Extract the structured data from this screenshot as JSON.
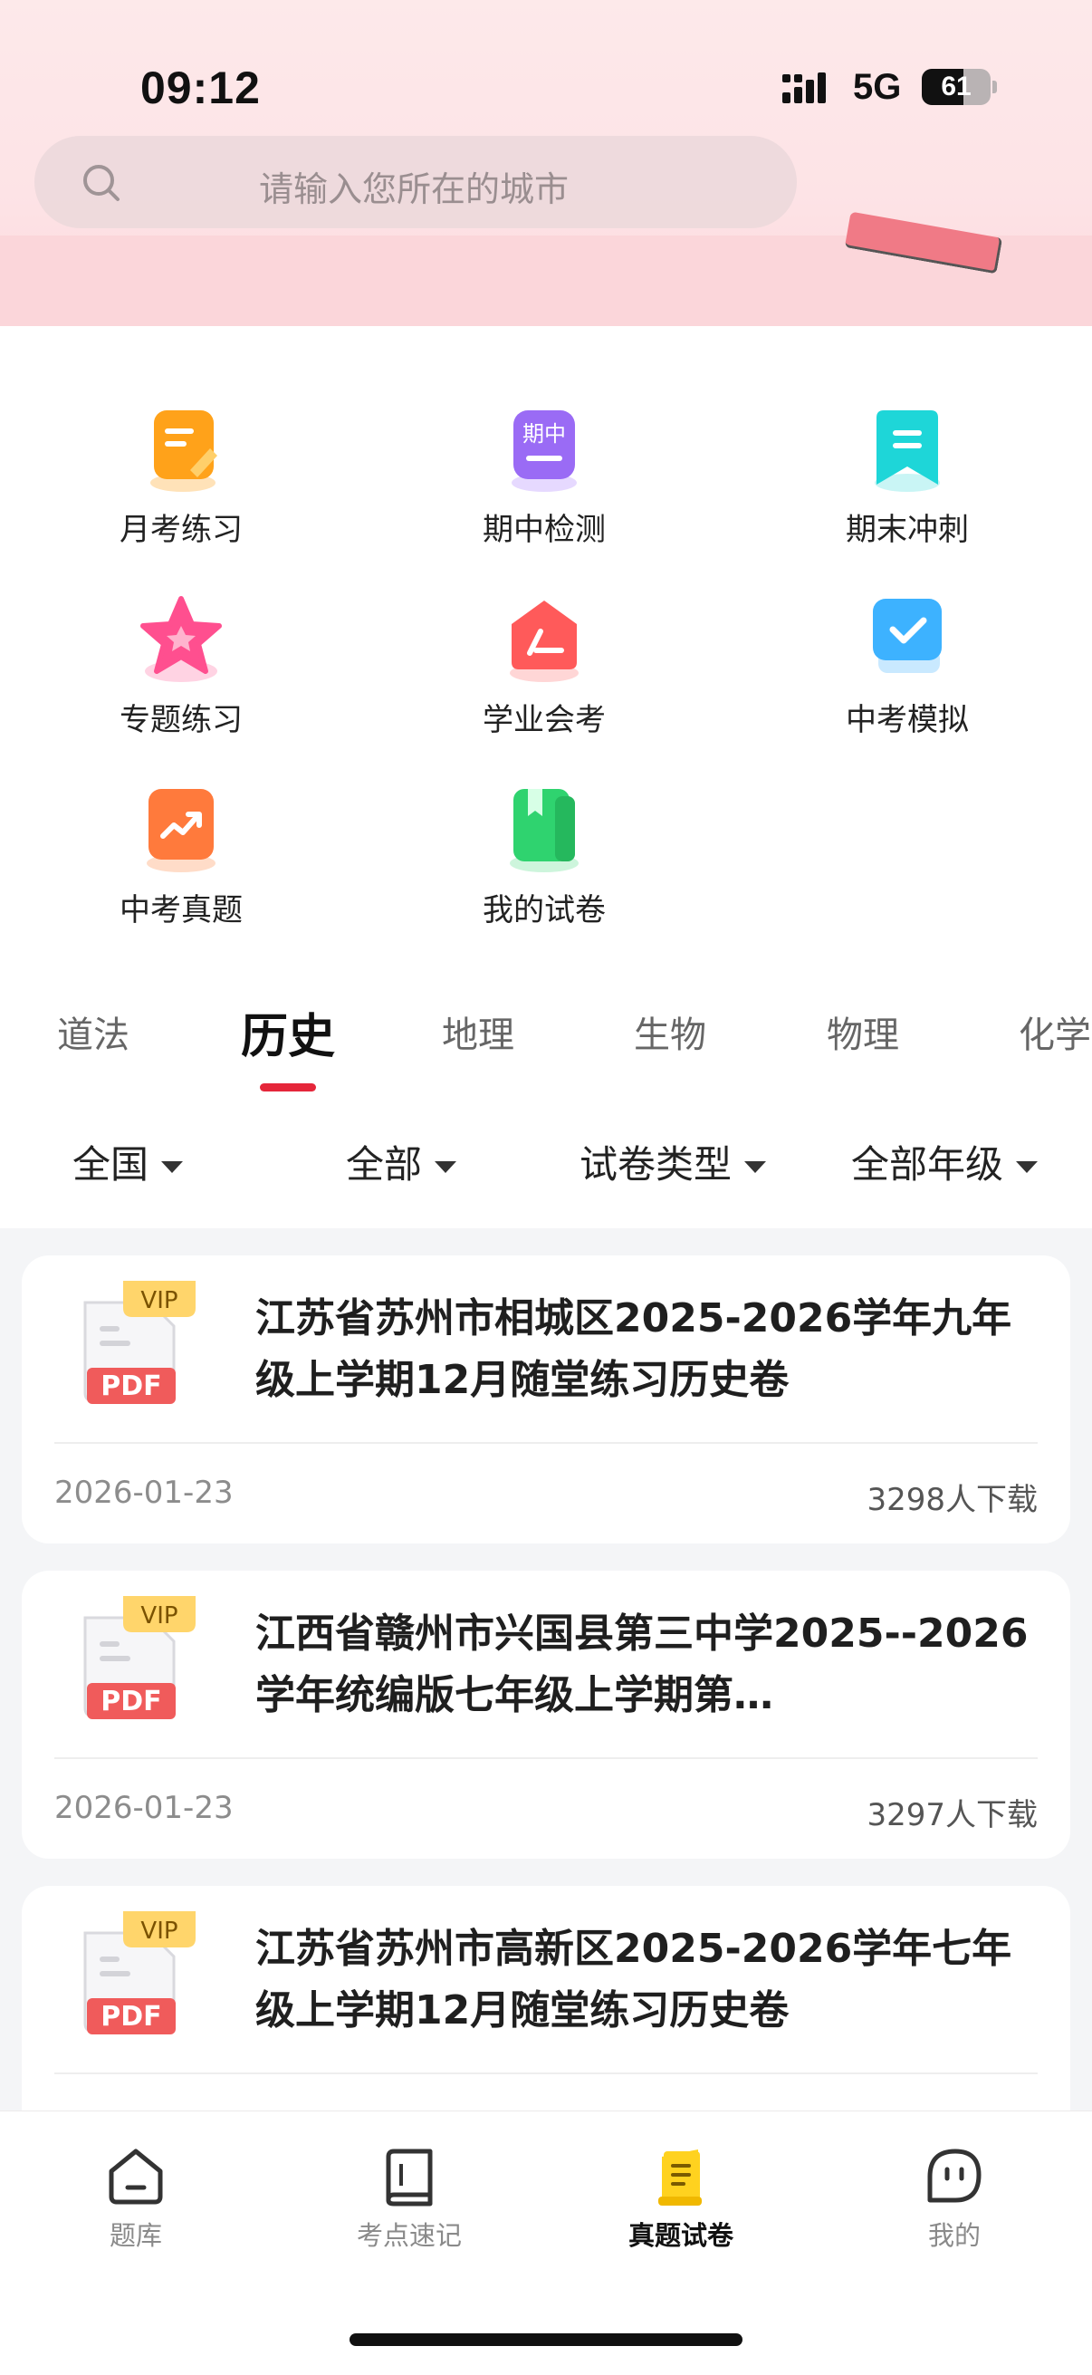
{
  "status_bar": {
    "time": "09:12",
    "network": "5G",
    "battery": "61",
    "battery_level": 0.61
  },
  "search": {
    "placeholder": "请输入您所在的城市"
  },
  "menu": {
    "items": [
      {
        "label": "月考练习",
        "icon": "monthly-exam-icon",
        "color": "#ffa21a"
      },
      {
        "label": "期中检测",
        "icon": "midterm-icon",
        "color": "#9a6bf5",
        "badge": "期中"
      },
      {
        "label": "期末冲刺",
        "icon": "final-sprint-icon",
        "color": "#1ed6d8"
      },
      {
        "label": "专题练习",
        "icon": "star-icon",
        "color": "#ff4f8f"
      },
      {
        "label": "学业会考",
        "icon": "academic-exam-icon",
        "color": "#ff5a5a"
      },
      {
        "label": "中考模拟",
        "icon": "checkmark-icon",
        "color": "#3db2ff"
      },
      {
        "label": "中考真题",
        "icon": "trend-icon",
        "color": "#ff7a3c"
      },
      {
        "label": "我的试卷",
        "icon": "my-papers-icon",
        "color": "#2fd36f"
      }
    ]
  },
  "subjects": {
    "tabs": [
      "道法",
      "历史",
      "地理",
      "生物",
      "物理",
      "化学"
    ],
    "active_index": 1,
    "accent": "#e5263a"
  },
  "filters": {
    "region": "全国",
    "scope": "全部",
    "paper_type": "试卷类型",
    "grade": "全部年级"
  },
  "papers": [
    {
      "badge": "VIP",
      "format": "PDF",
      "title": "江苏省苏州市相城区2025-2026学年九年级上学期12月随堂练习历史卷",
      "date": "2026-01-23",
      "downloads": "3298人下载"
    },
    {
      "badge": "VIP",
      "format": "PDF",
      "title": "江西省赣州市兴国县第三中学2025--2026学年统编版七年级上学期第…",
      "date": "2026-01-23",
      "downloads": "3297人下载"
    },
    {
      "badge": "VIP",
      "format": "PDF",
      "title": "江苏省苏州市高新区2025-2026学年七年级上学期12月随堂练习历史卷",
      "date": "",
      "downloads": ""
    }
  ],
  "bottom_nav": {
    "items": [
      {
        "label": "题库",
        "icon": "home-icon"
      },
      {
        "label": "考点速记",
        "icon": "book-icon"
      },
      {
        "label": "真题试卷",
        "icon": "scroll-icon"
      },
      {
        "label": "我的",
        "icon": "face-icon"
      }
    ],
    "active_index": 2,
    "active_color": "#ffd21f"
  }
}
